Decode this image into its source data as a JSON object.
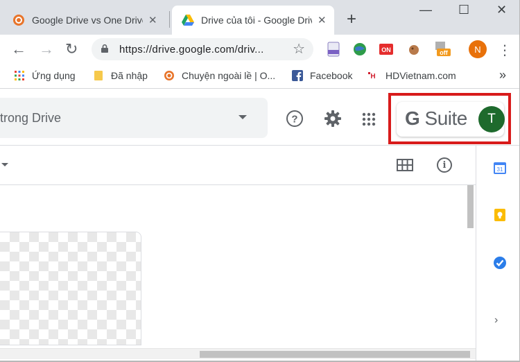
{
  "tabs": [
    {
      "title": "Google Drive vs One Drive",
      "close": "✕",
      "favicon": "circle-orange-icon"
    },
    {
      "title": "Drive của tôi - Google Drive",
      "close": "✕",
      "favicon": "google-drive-icon"
    }
  ],
  "new_tab": "+",
  "window_controls": {
    "minimize": "—",
    "maximize": "☐",
    "close": "✕"
  },
  "toolbar": {
    "back": "←",
    "forward": "→",
    "reload": "↻",
    "url": "https://drive.google.com/driv...",
    "star": "☆",
    "profile_initial": "N",
    "menu": "⋮"
  },
  "bookmarks": [
    {
      "label": "Ứng dụng",
      "icon": "apps-grid-icon"
    },
    {
      "label": "Đã nhập",
      "icon": "folder-icon"
    },
    {
      "label": "Chuyện ngoài lề | O...",
      "icon": "circle-orange-icon"
    },
    {
      "label": "Facebook",
      "icon": "facebook-icon"
    },
    {
      "label": "HDVietnam.com",
      "icon": "hdvietnam-icon"
    }
  ],
  "bookmarks_more": "»",
  "drive": {
    "search_placeholder": "trong Drive",
    "help": "?",
    "settings": "⚙",
    "apps": "⋮⋮⋮",
    "gsuite_label_g": "G",
    "gsuite_label_rest": " Suite",
    "avatar_initial": "T",
    "info": "i",
    "side_expand": "›"
  },
  "colors": {
    "highlight_border": "#d81b1b",
    "avatar_bg": "#1e6a2d",
    "profile_bg": "#e8710a"
  }
}
